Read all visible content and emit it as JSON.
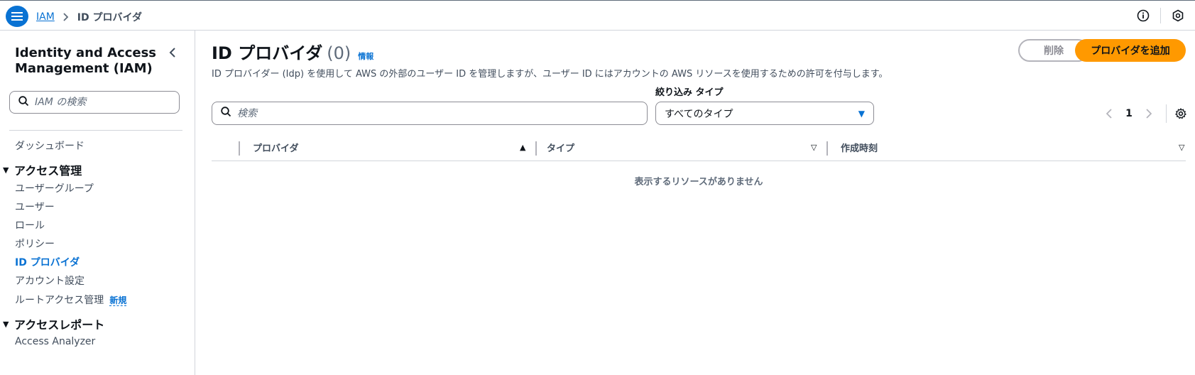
{
  "breadcrumb": {
    "root": "IAM",
    "current": "ID プロバイダ"
  },
  "sidebar": {
    "title": "Identity and Access Management (IAM)",
    "search_placeholder": "IAM の検索",
    "dashboard": "ダッシュボード",
    "access_management": {
      "label": "アクセス管理",
      "items": [
        "ユーザーグループ",
        "ユーザー",
        "ロール",
        "ポリシー",
        "ID プロバイダ",
        "アカウント設定",
        "ルートアクセス管理"
      ],
      "active": "ID プロバイダ",
      "new_badge": "新規"
    },
    "access_reports": {
      "label": "アクセスレポート",
      "items": [
        "Access Analyzer"
      ]
    }
  },
  "main": {
    "title": "ID プロバイダ",
    "count": "(0)",
    "info": "情報",
    "description": "ID プロバイダー (Idp) を使用して AWS の外部のユーザー ID を管理しますが、ユーザー ID にはアカウントの AWS リソースを使用するための許可を付与します。",
    "delete_label": "削除",
    "add_label": "プロバイダを追加",
    "search_placeholder": "検索",
    "filter_label": "絞り込み タイプ",
    "filter_value": "すべてのタイプ",
    "page_number": "1",
    "columns": [
      "プロバイダ",
      "タイプ",
      "作成時刻"
    ],
    "empty_message": "表示するリソースがありません"
  },
  "colors": {
    "accent": "#0972d3",
    "primary_button": "#ff9900",
    "border": "#d1d5db"
  }
}
